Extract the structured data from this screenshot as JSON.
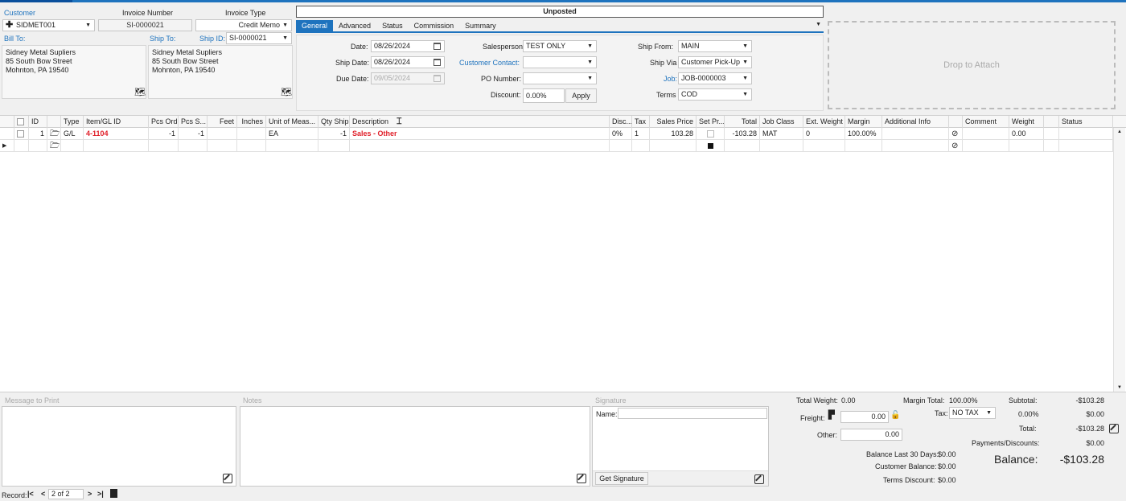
{
  "header": {
    "customer_label": "Customer",
    "customer_value": "SIDMET001",
    "invoice_number_label": "Invoice Number",
    "invoice_number_value": "SI-0000021",
    "invoice_type_label": "Invoice Type",
    "invoice_type_value": "Credit Memo",
    "status_value": "Unposted",
    "bill_to_label": "Bill To:",
    "ship_to_label": "Ship To:",
    "ship_id_label": "Ship ID:",
    "ship_id_value": "SI-0000021",
    "bill_to_address": "Sidney Metal Supliers\n85 South Bow Street\nMohnton, PA 19540",
    "ship_to_address": "Sidney Metal Supliers\n85 South Bow Street\nMohnton, PA 19540",
    "attach_label": "Drop to Attach"
  },
  "tabs": [
    "General",
    "Advanced",
    "Status",
    "Commission",
    "Summary"
  ],
  "general": {
    "date_label": "Date:",
    "date_value": "08/26/2024",
    "ship_date_label": "Ship Date:",
    "ship_date_value": "08/26/2024",
    "due_date_label": "Due Date:",
    "due_date_value": "09/05/2024",
    "salesperson_label": "Salesperson",
    "salesperson_value": "TEST ONLY",
    "customer_contact_label": "Customer Contact:",
    "customer_contact_value": "",
    "po_number_label": "PO Number:",
    "po_number_value": "",
    "discount_label": "Discount:",
    "discount_value": "0.00%",
    "apply_label": "Apply",
    "ship_from_label": "Ship From:",
    "ship_from_value": "MAIN",
    "ship_via_label": "Ship Via",
    "ship_via_value": "Customer Pick-Up",
    "job_label": "Job:",
    "job_value": "JOB-0000003",
    "terms_label": "Terms",
    "terms_value": "COD"
  },
  "grid": {
    "columns": [
      "ID",
      "Type",
      "Item/GL ID",
      "Pcs Ord",
      "Pcs S...",
      "Feet",
      "Inches",
      "Unit of Meas...",
      "Qty Ship",
      "Description",
      "Disc...",
      "Tax",
      "Sales Price",
      "Set Pr...",
      "Total",
      "Job Class",
      "Ext. Weight",
      "Margin",
      "Additional Info",
      "Comment",
      "Weight",
      "Status"
    ],
    "rows": [
      {
        "id": "1",
        "type": "G/L",
        "item": "4-1104",
        "pcs_ord": "-1",
        "pcs_s": "-1",
        "feet": "",
        "inches": "",
        "uom": "EA",
        "qty_ship": "-1",
        "description": "Sales - Other",
        "disc": "0%",
        "tax": "1",
        "sales_price": "103.28",
        "total": "-103.28",
        "job_class": "MAT",
        "ext_weight": "0",
        "margin": "100.00%",
        "additional_info": "",
        "comment": "",
        "weight": "0.00",
        "status": ""
      }
    ]
  },
  "bottom": {
    "message_label": "Message to Print",
    "notes_label": "Notes",
    "signature_label": "Signature",
    "name_label": "Name:",
    "get_signature_label": "Get Signature"
  },
  "totals": {
    "total_weight_label": "Total Weight:",
    "total_weight_value": "0.00",
    "margin_total_label": "Margin Total:",
    "margin_total_value": "100.00%",
    "freight_label": "Freight:",
    "freight_value": "0.00",
    "tax_label": "Tax:",
    "tax_value": "NO TAX",
    "tax_rate": "0.00%",
    "other_label": "Other:",
    "other_value": "0.00",
    "subtotal_label": "Subtotal:",
    "subtotal_value": "-$103.28",
    "tax_amount": "$0.00",
    "total_label": "Total:",
    "total_value": "-$103.28",
    "payments_label": "Payments/Discounts:",
    "payments_value": "$0.00",
    "balance_label": "Balance:",
    "balance_value": "-$103.28",
    "balance_30_label": "Balance Last 30 Days:",
    "balance_30_value": "$0.00",
    "customer_balance_label": "Customer Balance:",
    "customer_balance_value": "$0.00",
    "terms_discount_label": "Terms Discount:",
    "terms_discount_value": "$0.00"
  },
  "record": {
    "label": "Record:",
    "position": "2 of 2"
  }
}
